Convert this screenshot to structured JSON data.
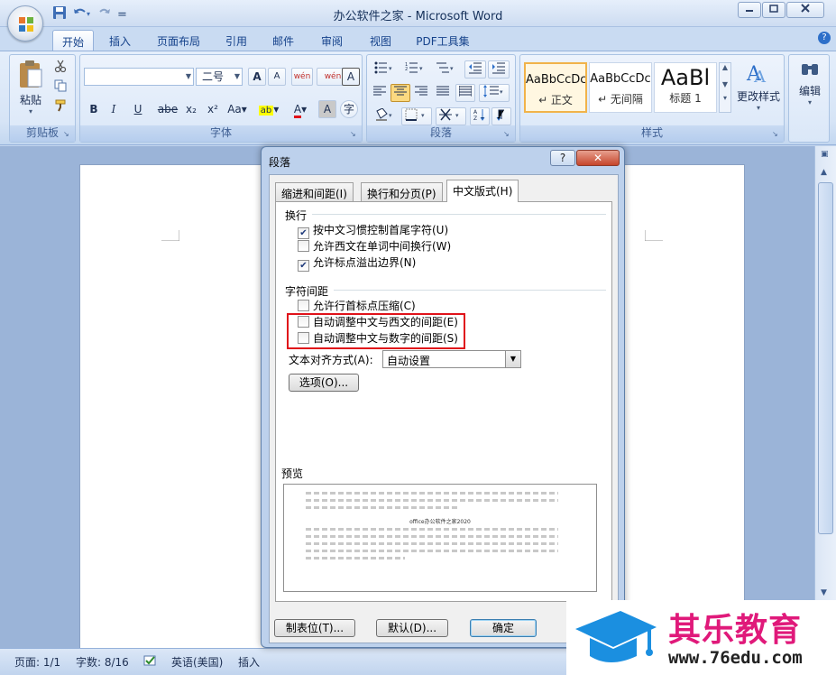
{
  "window": {
    "title": "办公软件之家 - Microsoft Word",
    "qat_separator": "=",
    "controls": {
      "minimize": "▭",
      "restore": "⧉",
      "close": "✕"
    }
  },
  "ribbon_tabs": [
    "开始",
    "插入",
    "页面布局",
    "引用",
    "邮件",
    "审阅",
    "视图",
    "PDF工具集"
  ],
  "ribbon": {
    "clipboard": {
      "paste": "粘贴",
      "label": "剪贴板"
    },
    "font": {
      "name_value": "",
      "size_value": "二号",
      "label": "字体",
      "bold": "B",
      "italic": "I",
      "underline": "U",
      "strike": "abe",
      "subscript": "x₂",
      "superscript": "x²",
      "case": "Aa",
      "grow": "A",
      "shrink": "A",
      "clear": "wén",
      "char_border": "A",
      "highlight": "ab",
      "font_color": "A",
      "char_shade": "A",
      "enclose": "字"
    },
    "paragraph": {
      "label": "段落"
    },
    "styles": {
      "label": "样式",
      "items": [
        {
          "preview": "AaBbCcDc",
          "name": "↵ 正文"
        },
        {
          "preview": "AaBbCcDc",
          "name": "↵ 无间隔"
        },
        {
          "preview": "AaBl",
          "name": "标题 1"
        }
      ],
      "change_styles": "更改样式"
    },
    "editing": {
      "label": "编辑"
    }
  },
  "dialog": {
    "title": "段落",
    "help": "?",
    "close": "✕",
    "tabs": [
      "缩进和间距(I)",
      "换行和分页(P)",
      "中文版式(H)"
    ],
    "section_wrap": "换行",
    "wrap_options": [
      {
        "label": "按中文习惯控制首尾字符(U)",
        "checked": "✔"
      },
      {
        "label": "允许西文在单词中间换行(W)",
        "checked": ""
      },
      {
        "label": "允许标点溢出边界(N)",
        "checked": "✔"
      }
    ],
    "section_spacing": "字符间距",
    "spacing_options": [
      {
        "label": "允许行首标点压缩(C)",
        "checked": ""
      },
      {
        "label": "自动调整中文与西文的间距(E)",
        "checked": ""
      },
      {
        "label": "自动调整中文与数字的间距(S)",
        "checked": ""
      }
    ],
    "text_align_label": "文本对齐方式(A):",
    "text_align_value": "自动设置",
    "options_button": "选项(O)...",
    "preview_label": "预览",
    "preview_text": "office办公软件之家2020",
    "buttons": {
      "tabs": "制表位(T)...",
      "default": "默认(D)...",
      "ok": "确定"
    }
  },
  "status": {
    "page": "页面: 1/1",
    "words": "字数: 8/16",
    "language": "英语(美国)",
    "mode": "插入"
  },
  "watermark": {
    "name": "其乐教育",
    "url": "www.76edu.com"
  },
  "colors": {
    "accent": "#15428b",
    "highlight_box": "#e0121a",
    "watermark_pink": "#e0197a"
  }
}
